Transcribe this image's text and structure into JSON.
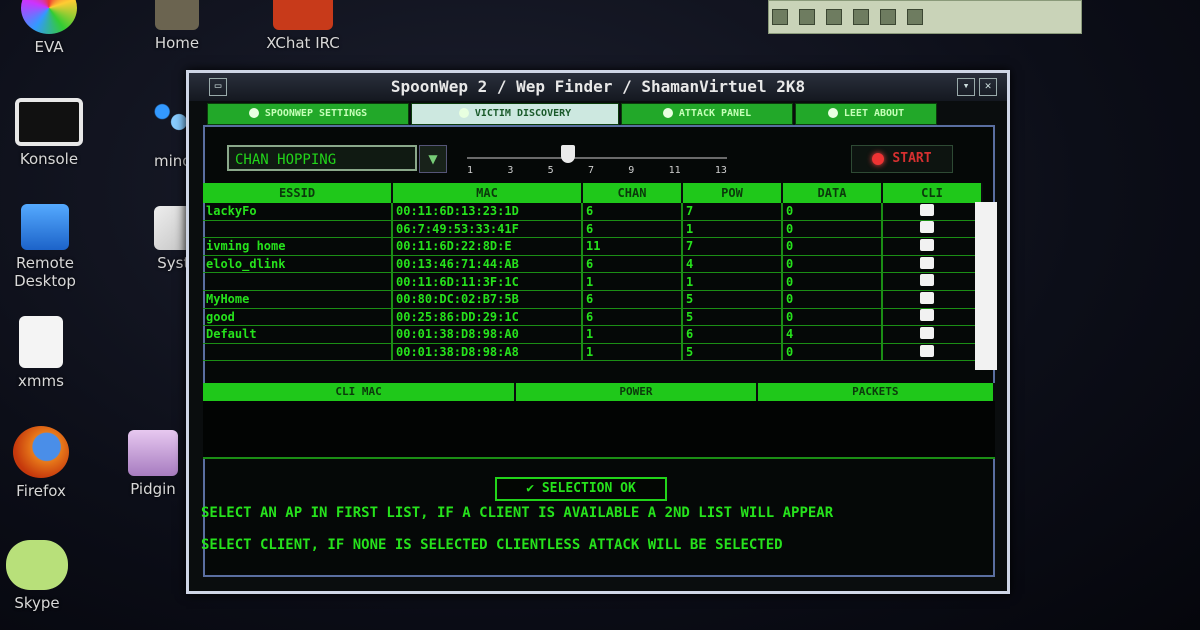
{
  "desktop": {
    "icons": [
      {
        "label": "EVA",
        "icon": "eva-icon"
      },
      {
        "label": "Home",
        "icon": "home-folder-icon"
      },
      {
        "label": "XChat IRC",
        "icon": "xchat-icon"
      },
      {
        "label": "Konsole",
        "icon": "terminal-icon"
      },
      {
        "label": "mindw",
        "icon": "mindmap-icon"
      },
      {
        "label": "Remote Desktop",
        "icon": "remote-desktop-icon"
      },
      {
        "label": "Syster",
        "icon": "system-icon"
      },
      {
        "label": "xmms",
        "icon": "xmms-icon"
      },
      {
        "label": "Firefox",
        "icon": "firefox-icon"
      },
      {
        "label": "Pidgin",
        "icon": "pidgin-icon"
      },
      {
        "label": "Skype",
        "icon": "skype-icon"
      }
    ]
  },
  "window": {
    "title": "SpoonWep 2 / Wep Finder / ShamanVirtuel 2K8",
    "tabs": [
      {
        "label": "SPOONWEP SETTINGS",
        "active": false
      },
      {
        "label": "VICTIM DISCOVERY",
        "active": true
      },
      {
        "label": "ATTACK PANEL",
        "active": false
      },
      {
        "label": "LEET ABOUT",
        "active": false
      }
    ],
    "channel_mode": "CHAN HOPPING",
    "channel_ticks": [
      "1",
      "3",
      "5",
      "7",
      "9",
      "11",
      "13"
    ],
    "start_label": "START",
    "ap_table": {
      "columns": [
        "ESSID",
        "MAC",
        "CHAN",
        "POW",
        "DATA",
        "CLI"
      ],
      "rows": [
        [
          "lackyFo",
          "00:11:6D:13:23:1D",
          "6",
          "7",
          "0",
          ""
        ],
        [
          "",
          "06:7:49:53:33:41F",
          "6",
          "1",
          "0",
          ""
        ],
        [
          "ivming home",
          "00:11:6D:22:8D:E",
          "11",
          "7",
          "0",
          ""
        ],
        [
          "elolo_dlink",
          "00:13:46:71:44:AB",
          "6",
          "4",
          "0",
          ""
        ],
        [
          "",
          "00:11:6D:11:3F:1C",
          "1",
          "1",
          "0",
          ""
        ],
        [
          "MyHome",
          "00:80:DC:02:B7:5B",
          "6",
          "5",
          "0",
          ""
        ],
        [
          "good",
          "00:25:86:DD:29:1C",
          "6",
          "5",
          "0",
          ""
        ],
        [
          "Default",
          "00:01:38:D8:98:A0",
          "1",
          "6",
          "4",
          ""
        ],
        [
          "",
          "00:01:38:D8:98:A8",
          "1",
          "5",
          "0",
          ""
        ]
      ]
    },
    "client_table": {
      "columns": [
        "CLI MAC",
        "POWER",
        "PACKETS"
      ]
    },
    "selection_button": "SELECTION OK",
    "messages": [
      "SELECT AN AP IN FIRST LIST, IF A CLIENT IS AVAILABLE A 2ND LIST WILL APPEAR",
      "SELECT CLIENT, IF NONE IS SELECTED CLIENTLESS ATTACK WILL BE SELECTED"
    ]
  }
}
